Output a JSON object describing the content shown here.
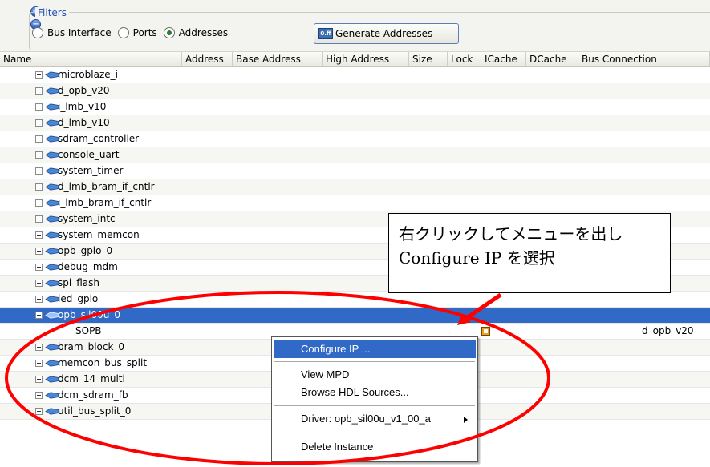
{
  "filters": {
    "legend": "Filters",
    "expand_symbol": "+",
    "collapse_symbol": "−",
    "options": [
      {
        "label": "Bus Interface",
        "checked": false
      },
      {
        "label": "Ports",
        "checked": false
      },
      {
        "label": "Addresses",
        "checked": true
      }
    ],
    "generate_button": "Generate Addresses",
    "generate_icon_text": "0.ff"
  },
  "table": {
    "columns": [
      "Name",
      "Address",
      "Base Address",
      "High Address",
      "Size",
      "Lock",
      "ICache",
      "DCache",
      "Bus Connection"
    ],
    "rows": [
      {
        "name": "microblaze_i",
        "expander": "minus"
      },
      {
        "name": "d_opb_v20",
        "expander": "plus"
      },
      {
        "name": "i_lmb_v10",
        "expander": "minus"
      },
      {
        "name": "d_lmb_v10",
        "expander": "minus"
      },
      {
        "name": "sdram_controller",
        "expander": "plus"
      },
      {
        "name": "console_uart",
        "expander": "plus"
      },
      {
        "name": "system_timer",
        "expander": "plus"
      },
      {
        "name": "d_lmb_bram_if_cntlr",
        "expander": "plus"
      },
      {
        "name": "i_lmb_bram_if_cntlr",
        "expander": "plus"
      },
      {
        "name": "system_intc",
        "expander": "plus"
      },
      {
        "name": "system_memcon",
        "expander": "plus"
      },
      {
        "name": "opb_gpio_0",
        "expander": "plus"
      },
      {
        "name": "debug_mdm",
        "expander": "plus"
      },
      {
        "name": "spi_flash",
        "expander": "plus"
      },
      {
        "name": "led_gpio",
        "expander": "plus"
      },
      {
        "name": "opb_sil00u_0",
        "expander": "minus",
        "selected": true
      },
      {
        "name": "SOPB",
        "child": true,
        "bus_connection": "d_opb_v20"
      },
      {
        "name": "bram_block_0",
        "expander": "minus"
      },
      {
        "name": "memcon_bus_split",
        "expander": "minus"
      },
      {
        "name": "dcm_14_multi",
        "expander": "minus"
      },
      {
        "name": "dcm_sdram_fb",
        "expander": "minus"
      },
      {
        "name": "util_bus_split_0",
        "expander": "minus"
      }
    ]
  },
  "callout": {
    "line1": "右クリックしてメニューを出し",
    "line2": "Configure IP を選択"
  },
  "context_menu": {
    "items": [
      {
        "label": "Configure IP ..."
      },
      {
        "label": "View MPD"
      },
      {
        "label": "Browse HDL Sources..."
      },
      {
        "label": "Driver: opb_sil00u_v1_00_a"
      },
      {
        "label": "Delete Instance"
      }
    ]
  },
  "colors": {
    "selection": "#3169c6",
    "annotation": "#ff0000"
  }
}
